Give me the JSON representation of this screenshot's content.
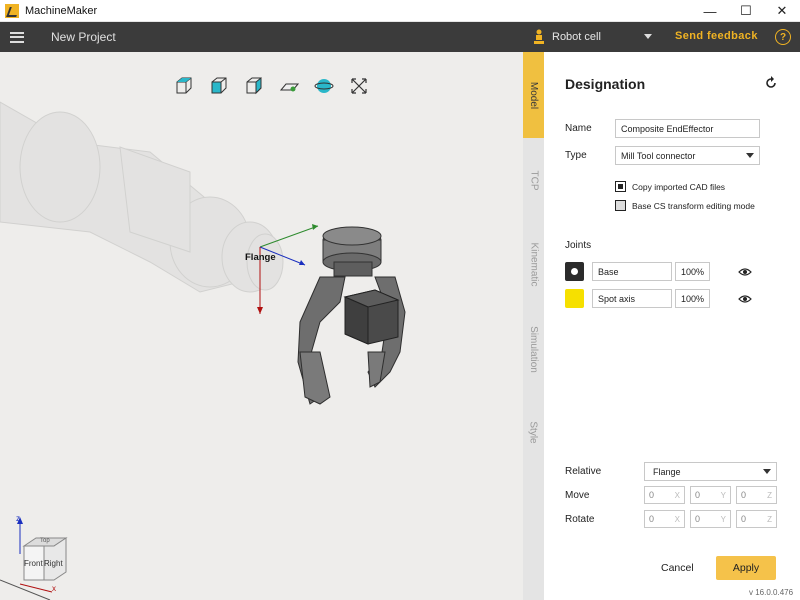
{
  "window": {
    "app_title": "MachineMaker",
    "minimize": "—",
    "maximize": "☐",
    "close": "✕"
  },
  "topbar": {
    "project_name": "New Project",
    "robot_cell": "Robot cell",
    "send_feedback": "Send feedback",
    "help": "?"
  },
  "viewport": {
    "toolbar": [
      "view-top-icon",
      "view-front-icon",
      "view-side-icon",
      "plane-icon",
      "sphere-icon",
      "fit-icon"
    ],
    "flange_label": "Flange",
    "view_cube": {
      "front": "Front",
      "right": "Right",
      "top": "Top",
      "axis_z": "z",
      "axis_x": "x"
    }
  },
  "side_tabs": [
    {
      "label": "Model",
      "active": true
    },
    {
      "label": "TCP",
      "active": false
    },
    {
      "label": "Kinematic",
      "active": false
    },
    {
      "label": "Simulation",
      "active": false
    },
    {
      "label": "Style",
      "active": false
    }
  ],
  "panel": {
    "title": "Designation",
    "name_label": "Name",
    "name_value": "Composite EndEffector",
    "type_label": "Type",
    "type_value": "Mill Tool connector",
    "copy_cad_label": "Copy imported CAD files",
    "base_cs_label": "Base CS transform editing mode",
    "joints_label": "Joints",
    "joints": [
      {
        "name": "Base",
        "percent": "100%",
        "color": "#2b2b2b"
      },
      {
        "name": "Spot axis",
        "percent": "100%",
        "color": "#f6e000"
      }
    ],
    "relative_label": "Relative",
    "relative_value": "Flange",
    "move_label": "Move",
    "rotate_label": "Rotate",
    "move": [
      {
        "value": "0",
        "axis": "X"
      },
      {
        "value": "0",
        "axis": "Y"
      },
      {
        "value": "0",
        "axis": "Z"
      }
    ],
    "rotate": [
      {
        "value": "0",
        "axis": "X"
      },
      {
        "value": "0",
        "axis": "Y"
      },
      {
        "value": "0",
        "axis": "Z"
      }
    ],
    "cancel": "Cancel",
    "apply": "Apply",
    "version": "v 16.0.0.476"
  },
  "colors": {
    "accent": "#f0b323",
    "topbar": "#3b3b3b",
    "apply": "#f5c24a"
  }
}
